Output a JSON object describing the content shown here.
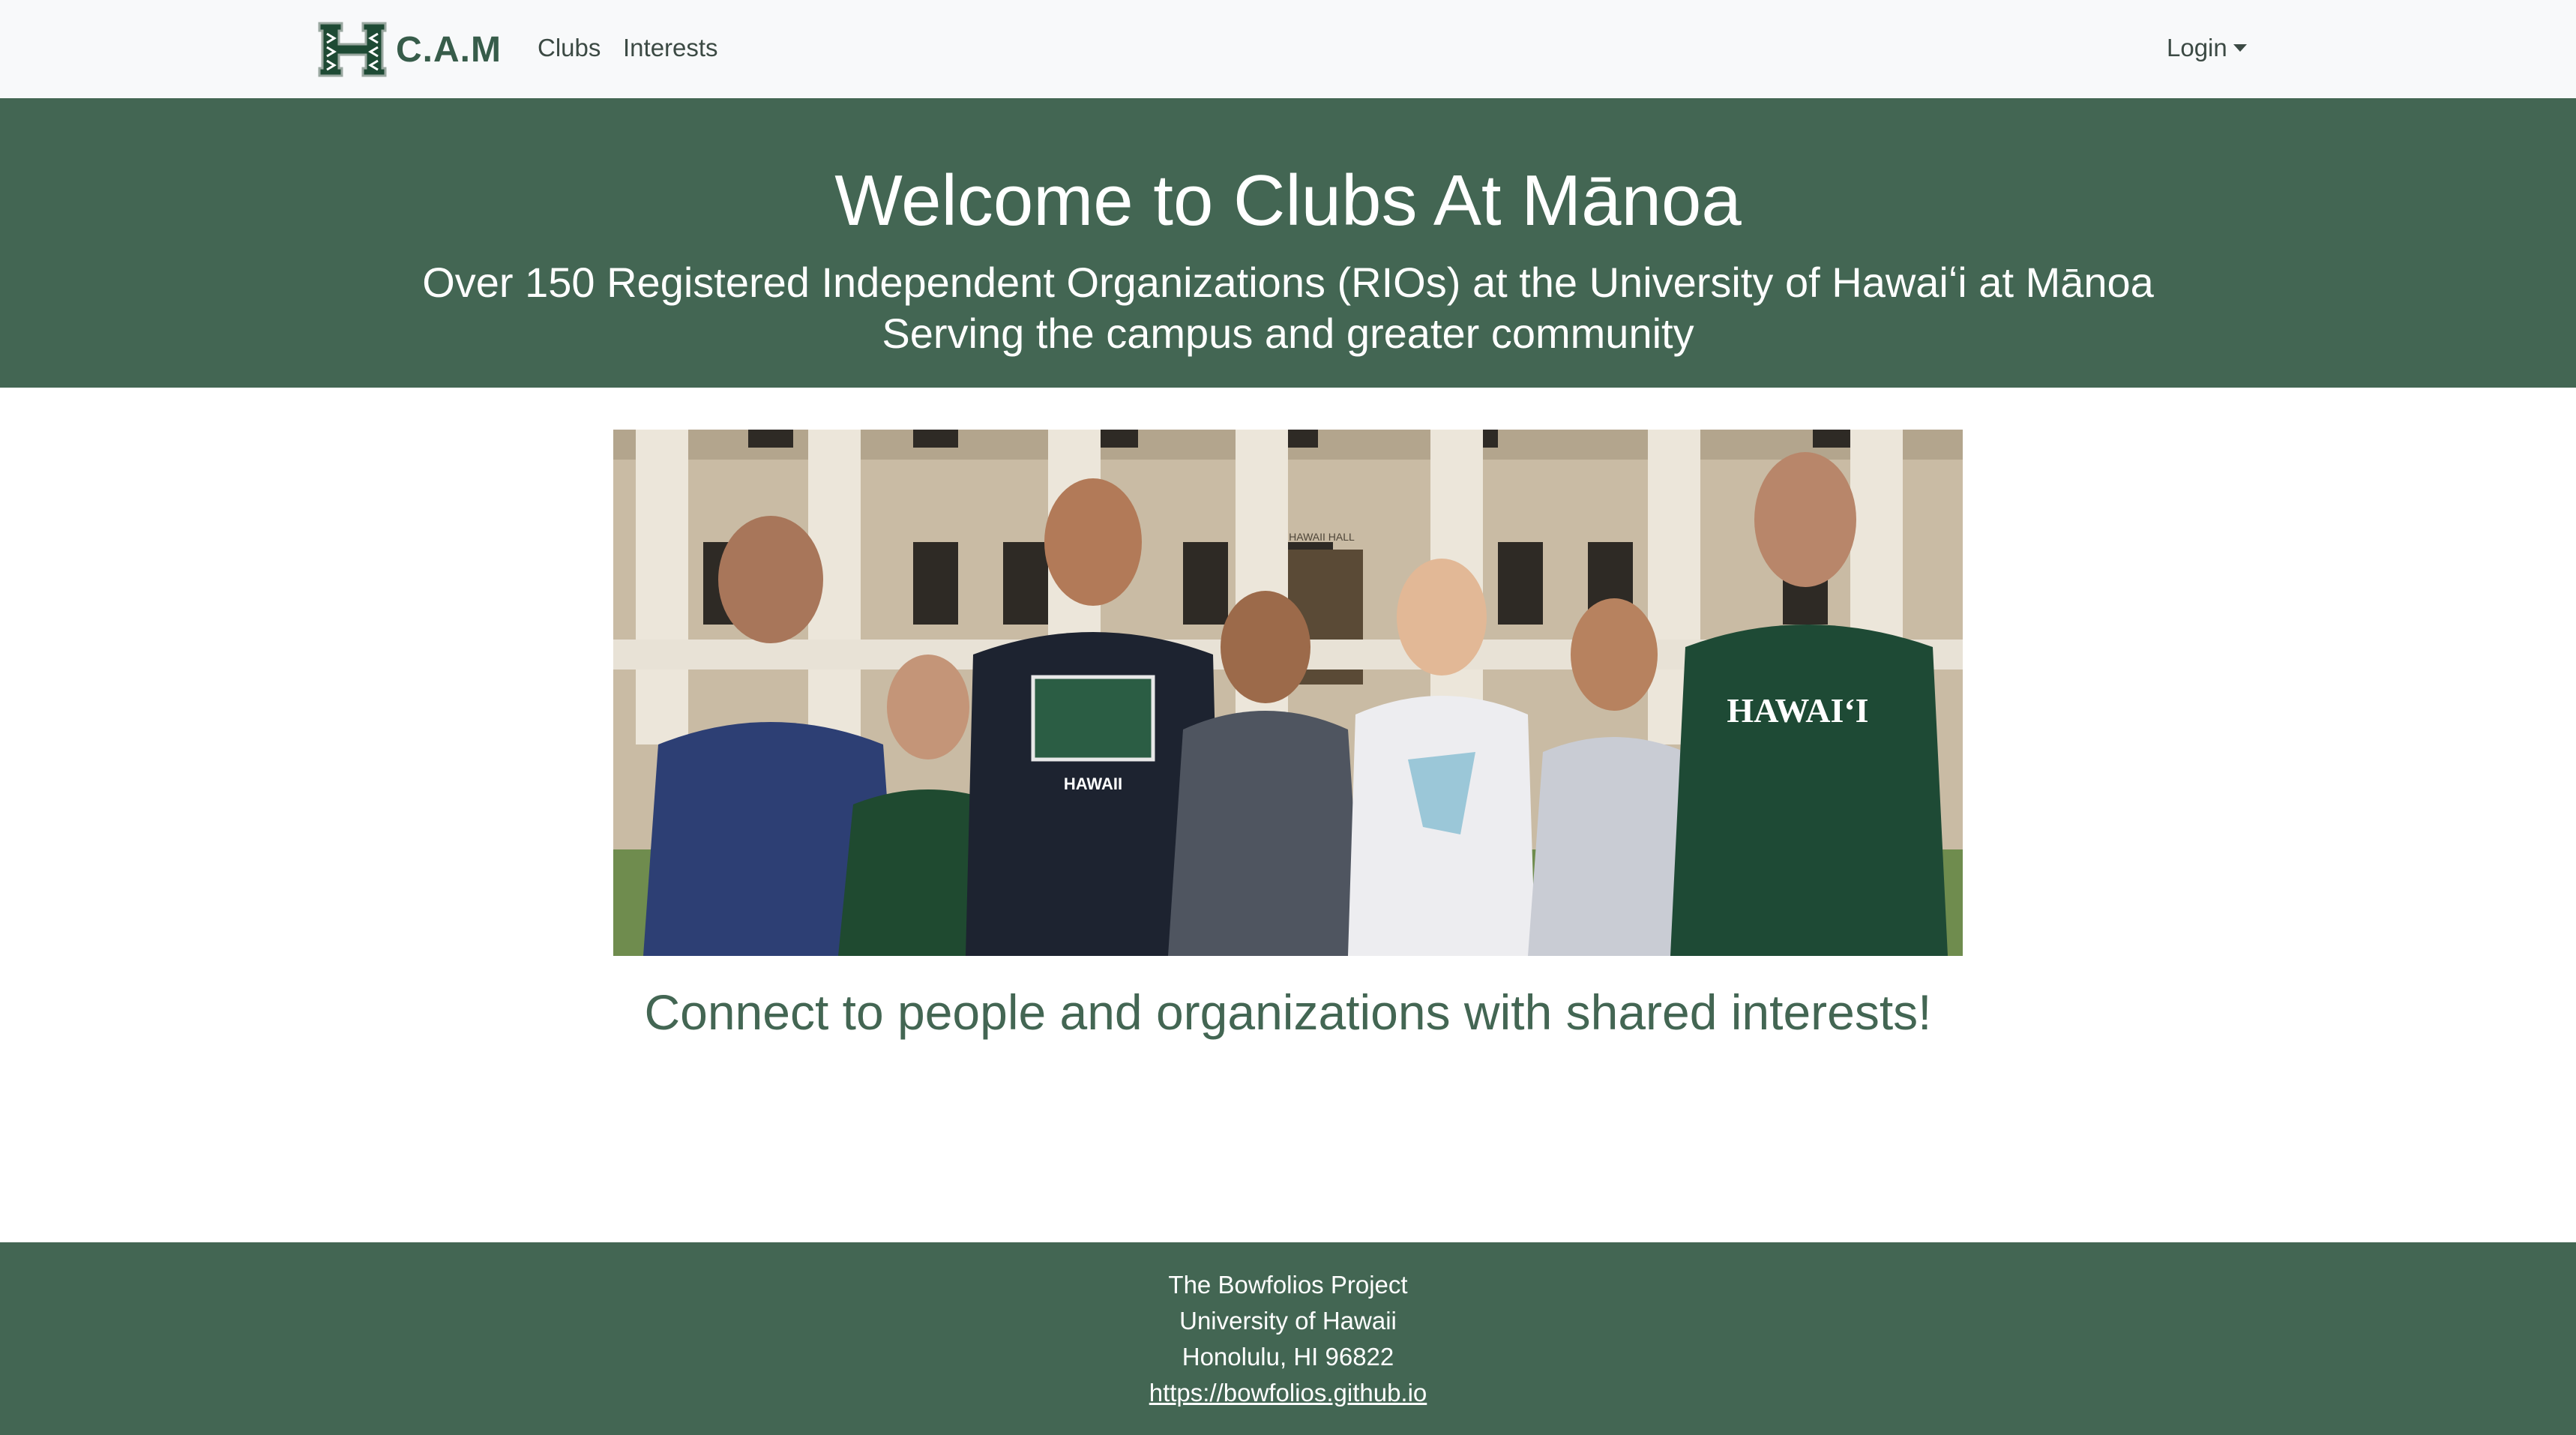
{
  "navbar": {
    "brand": "C.A.M",
    "links": [
      "Clubs",
      "Interests"
    ],
    "login_label": "Login",
    "logo_icon": "hawaii-h-logo-icon",
    "caret_icon": "caret-down-icon"
  },
  "hero": {
    "title": "Welcome to Clubs At Mānoa",
    "subtitle_1": "Over 150 Registered Independent Organizations (RIOs) at the University of Hawaiʻi at Mānoa",
    "subtitle_2": "Serving the campus and greater community"
  },
  "photo": {
    "building_sign": "HAWAII HALL",
    "shirt_text_1": "HAWAII",
    "shirt_text_2": "HAWAIʻI"
  },
  "tagline": "Connect to people and organizations with shared interests!",
  "footer": {
    "line1": "The Bowfolios Project",
    "line2": "University of Hawaii",
    "line3": "Honolulu, HI 96822",
    "link": "https://bowfolios.github.io"
  },
  "colors": {
    "brand_green": "#436653",
    "navbar_bg": "#f8f9fa",
    "text_white": "#ffffff"
  }
}
